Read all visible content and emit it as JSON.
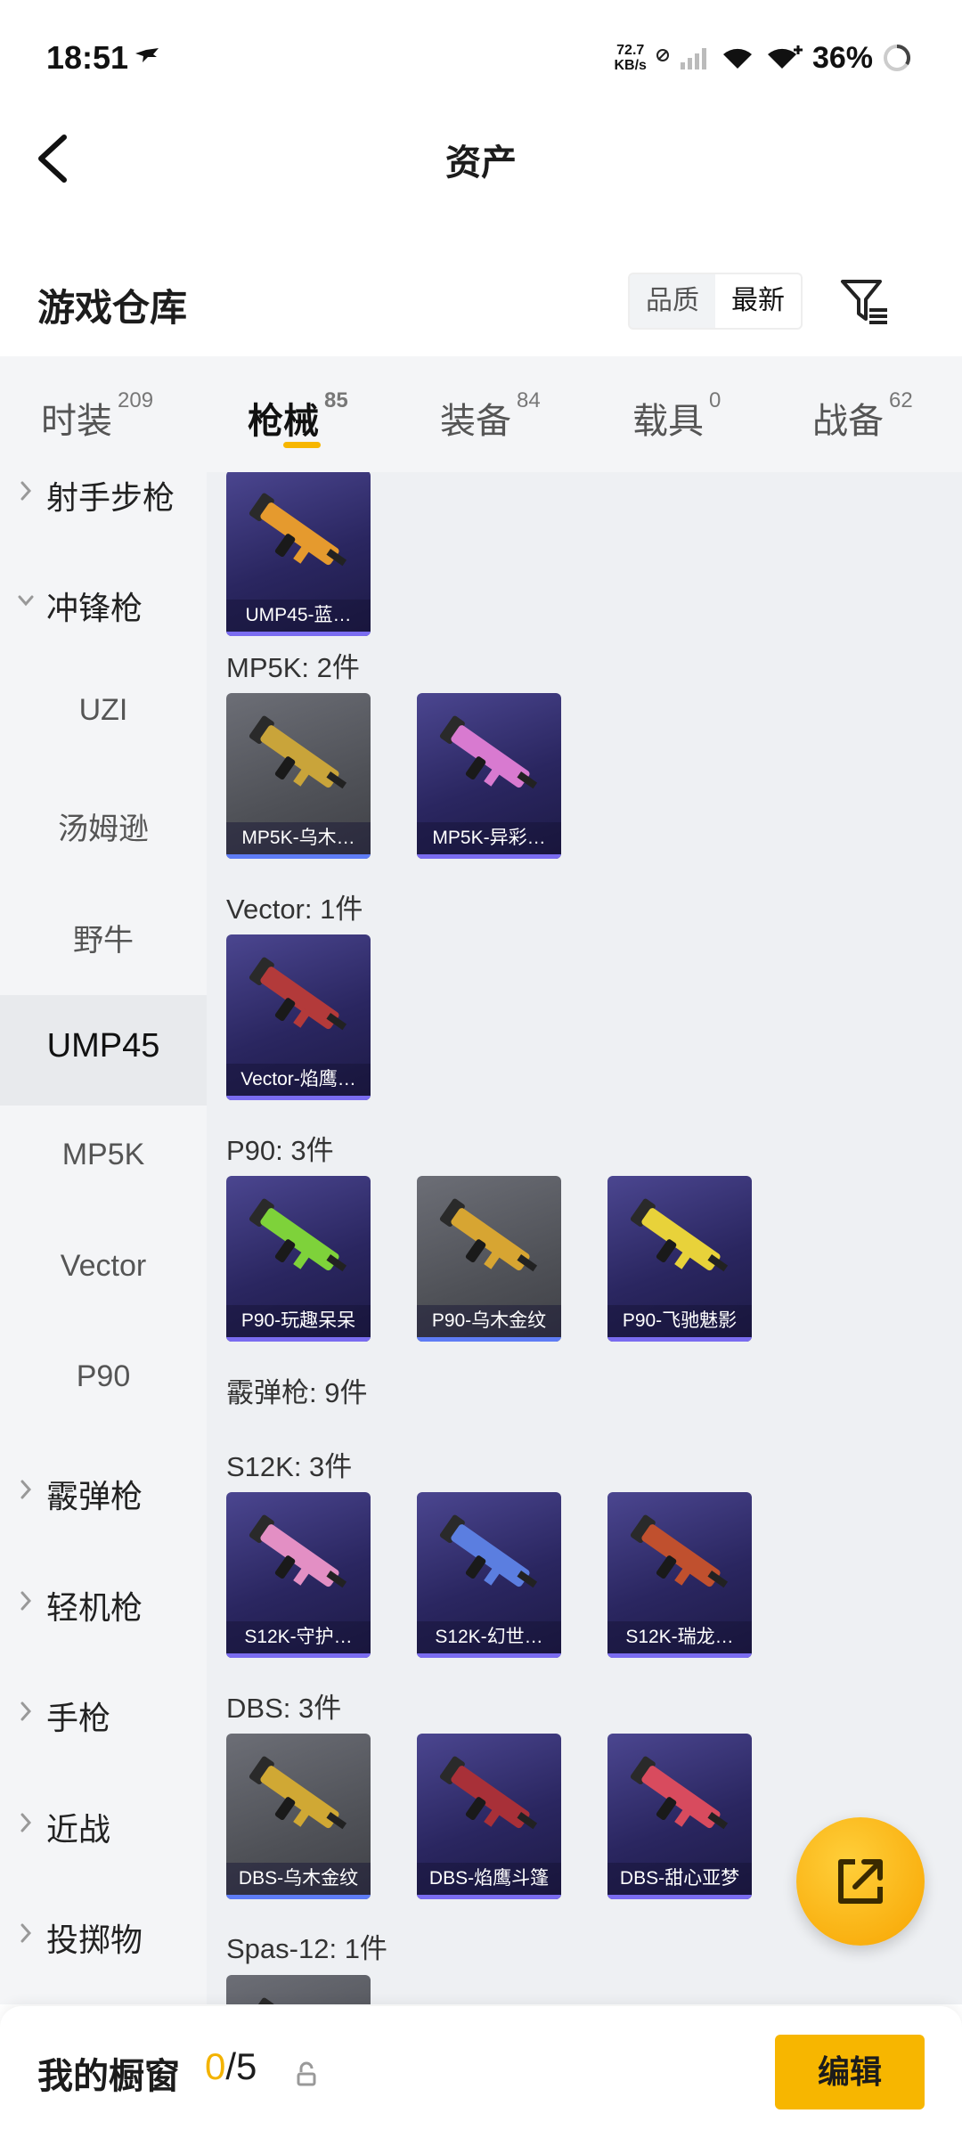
{
  "status_bar": {
    "time": "18:51",
    "net_speed_value": "72.7",
    "net_speed_unit": "KB/s",
    "battery": "36%"
  },
  "header": {
    "title": "资产"
  },
  "section": {
    "title": "游戏仓库",
    "sort_options": [
      "品质",
      "最新"
    ],
    "sort_selected": "最新"
  },
  "tabs": [
    {
      "label": "时装",
      "count": "209"
    },
    {
      "label": "枪械",
      "count": "85"
    },
    {
      "label": "装备",
      "count": "84"
    },
    {
      "label": "载具",
      "count": "0"
    },
    {
      "label": "战备",
      "count": "62"
    }
  ],
  "sidebar": [
    {
      "label": "射手步枪",
      "type": "category",
      "expanded": false
    },
    {
      "label": "冲锋枪",
      "type": "category",
      "expanded": true
    },
    {
      "label": "UZI",
      "type": "sub"
    },
    {
      "label": "汤姆逊",
      "type": "sub"
    },
    {
      "label": "野牛",
      "type": "sub"
    },
    {
      "label": "UMP45",
      "type": "sub",
      "selected": true
    },
    {
      "label": "MP5K",
      "type": "sub"
    },
    {
      "label": "Vector",
      "type": "sub"
    },
    {
      "label": "P90",
      "type": "sub"
    },
    {
      "label": "霰弹枪",
      "type": "category",
      "expanded": false
    },
    {
      "label": "轻机枪",
      "type": "category",
      "expanded": false
    },
    {
      "label": "手枪",
      "type": "category",
      "expanded": false
    },
    {
      "label": "近战",
      "type": "category",
      "expanded": false
    },
    {
      "label": "投掷物",
      "type": "category",
      "expanded": false
    }
  ],
  "groups": [
    {
      "label": "",
      "items": [
        {
          "name": "UMP45-蓝…",
          "style": "purple",
          "color": "#e59a2e"
        }
      ]
    },
    {
      "label": "MP5K: 2件",
      "items": [
        {
          "name": "MP5K-乌木…",
          "style": "gray",
          "color": "#c9a43a"
        },
        {
          "name": "MP5K-异彩…",
          "style": "purple",
          "color": "#d87ad0"
        }
      ]
    },
    {
      "label": "Vector: 1件",
      "items": [
        {
          "name": "Vector-焰鹰…",
          "style": "purple",
          "color": "#b33a3a"
        }
      ]
    },
    {
      "label": "P90: 3件",
      "items": [
        {
          "name": "P90-玩趣呆呆",
          "style": "purple",
          "color": "#7ed23a"
        },
        {
          "name": "P90-乌木金纹",
          "style": "gray",
          "color": "#d7a532"
        },
        {
          "name": "P90-飞驰魅影",
          "style": "purple",
          "color": "#e8d23a"
        }
      ]
    },
    {
      "label": "霰弹枪: 9件",
      "items": []
    },
    {
      "label": "S12K: 3件",
      "items": [
        {
          "name": "S12K-守护…",
          "style": "purple",
          "color": "#e38fc4"
        },
        {
          "name": "S12K-幻世…",
          "style": "purple",
          "color": "#5b7ee0"
        },
        {
          "name": "S12K-瑞龙…",
          "style": "purple",
          "color": "#c0502e"
        }
      ]
    },
    {
      "label": "DBS: 3件",
      "items": [
        {
          "name": "DBS-乌木金纹",
          "style": "gray",
          "color": "#d0a834"
        },
        {
          "name": "DBS-焰鹰斗篷",
          "style": "purple",
          "color": "#a83038"
        },
        {
          "name": "DBS-甜心亚梦",
          "style": "purple",
          "color": "#d84b5e"
        }
      ]
    },
    {
      "label": "Spas-12: 1件",
      "items": [
        {
          "name": "",
          "style": "gray",
          "color": "#8a6a3a"
        }
      ]
    }
  ],
  "showcase": {
    "label": "我的橱窗",
    "current": "0",
    "separator": "/",
    "total": "5",
    "edit_label": "编辑"
  },
  "colors": {
    "accent": "#f7b600",
    "sidebar_bg": "#f4f5f7",
    "content_bg": "#eef0f3"
  }
}
